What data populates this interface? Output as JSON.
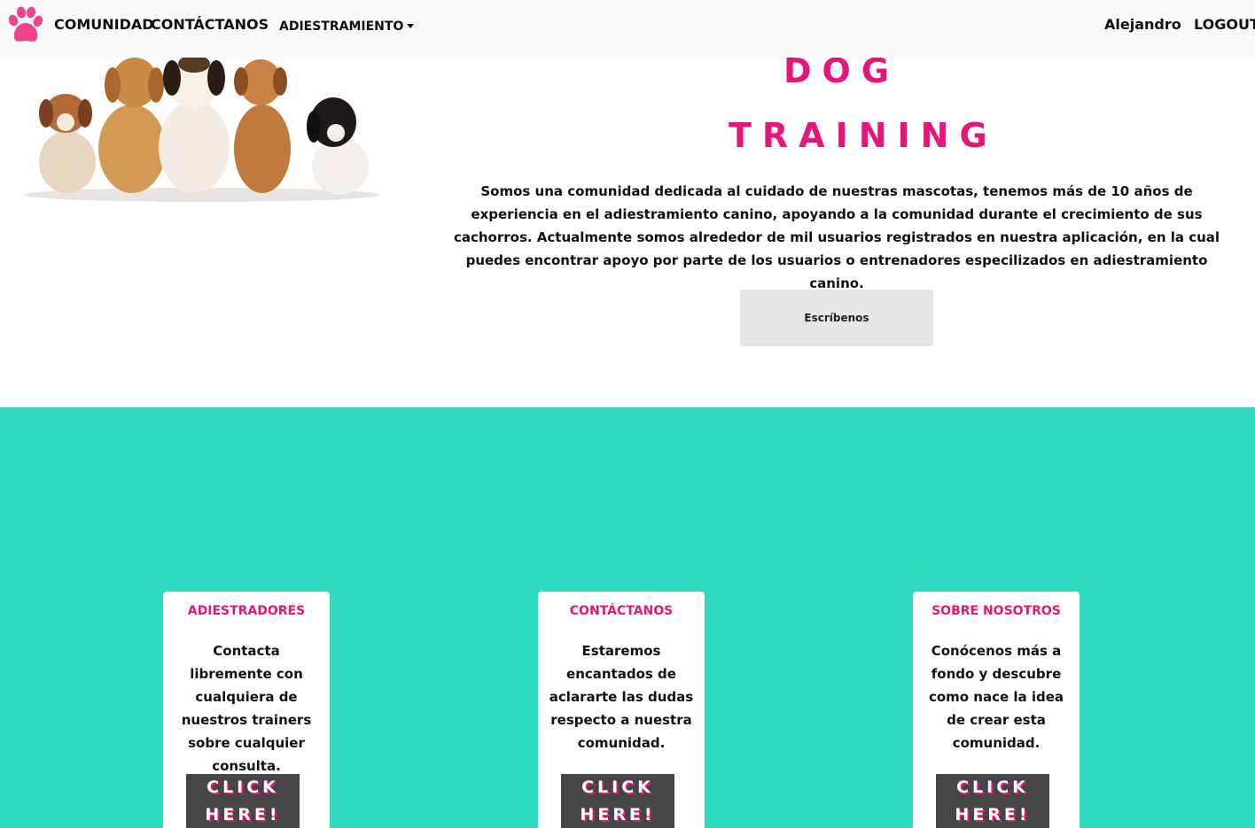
{
  "navbar": {
    "brand_icon": "paw-icon",
    "brand_color": "#f0428d",
    "links": [
      "COMUNIDAD",
      "CONTÁCTANOS"
    ],
    "dropdown_label": "ADIESTRAMIENTO",
    "user_name": "Alejandro",
    "logout_label": "LOGOUT"
  },
  "hero": {
    "title_line1": "DOG",
    "title_line2": "TRAINING",
    "accent_color": "#e6157a",
    "intro": "Somos una comunidad dedicada al cuidado de nuestras mascotas, tenemos más de 10 años de experiencia en el adiestramiento canino, apoyando a la comunidad durante el crecimiento de sus cachorros. Actualmente somos alrededor de mil usuarios registrados en nuestra aplicación, en la cual puedes encontrar apoyo por parte de los usuarios o entrenadores especilizados en adiestramiento canino.",
    "cta_label": "Escríbenos"
  },
  "section": {
    "background": "#2edbc0",
    "cards": [
      {
        "title": "ADIESTRADORES",
        "text": "Contacta libremente con cualquiera de nuestros trainers sobre cualquier consulta.",
        "button_line1": "CLICK",
        "button_line2": "HERE!"
      },
      {
        "title": "CONTÁCTANOS",
        "text": "Estaremos encantados de aclararte las dudas respecto a nuestra comunidad.",
        "button_line1": "CLICK",
        "button_line2": "HERE!"
      },
      {
        "title": "SOBRE NOSOTROS",
        "text": "Conócenos más a fondo y descubre como nace la idea de crear esta comunidad.",
        "button_line1": "CLICK",
        "button_line2": "HERE!"
      }
    ]
  }
}
